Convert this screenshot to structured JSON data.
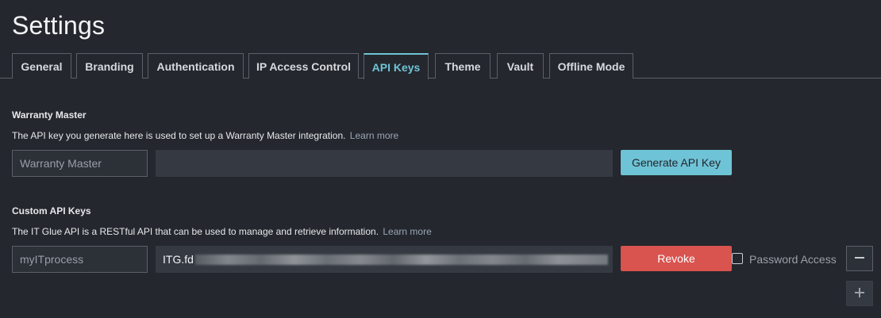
{
  "page": {
    "title": "Settings"
  },
  "tabs": [
    {
      "label": "General"
    },
    {
      "label": "Branding"
    },
    {
      "label": "Authentication"
    },
    {
      "label": "IP Access Control"
    },
    {
      "label": "API Keys",
      "active": true
    },
    {
      "label": "Theme"
    },
    {
      "label": "Vault"
    },
    {
      "label": "Offline Mode"
    }
  ],
  "warranty": {
    "title": "Warranty Master",
    "description": "The API key you generate here is used to set up a Warranty Master integration.",
    "learn_more": "Learn more",
    "name_value": "Warranty Master",
    "key_value": "",
    "generate_label": "Generate API Key"
  },
  "custom": {
    "title": "Custom API Keys",
    "description": "The IT Glue API is a RESTful API that can be used to manage and retrieve information.",
    "learn_more": "Learn more",
    "rows": [
      {
        "name_value": "myITprocess",
        "key_prefix": "ITG.fd",
        "revoke_label": "Revoke",
        "password_access_label": "Password Access",
        "password_access_checked": false
      }
    ]
  },
  "icons": {
    "remove": "minus-icon",
    "add": "plus-icon"
  },
  "colors": {
    "accent": "#6fc3d6",
    "danger": "#d9534f",
    "background": "#24272d"
  }
}
